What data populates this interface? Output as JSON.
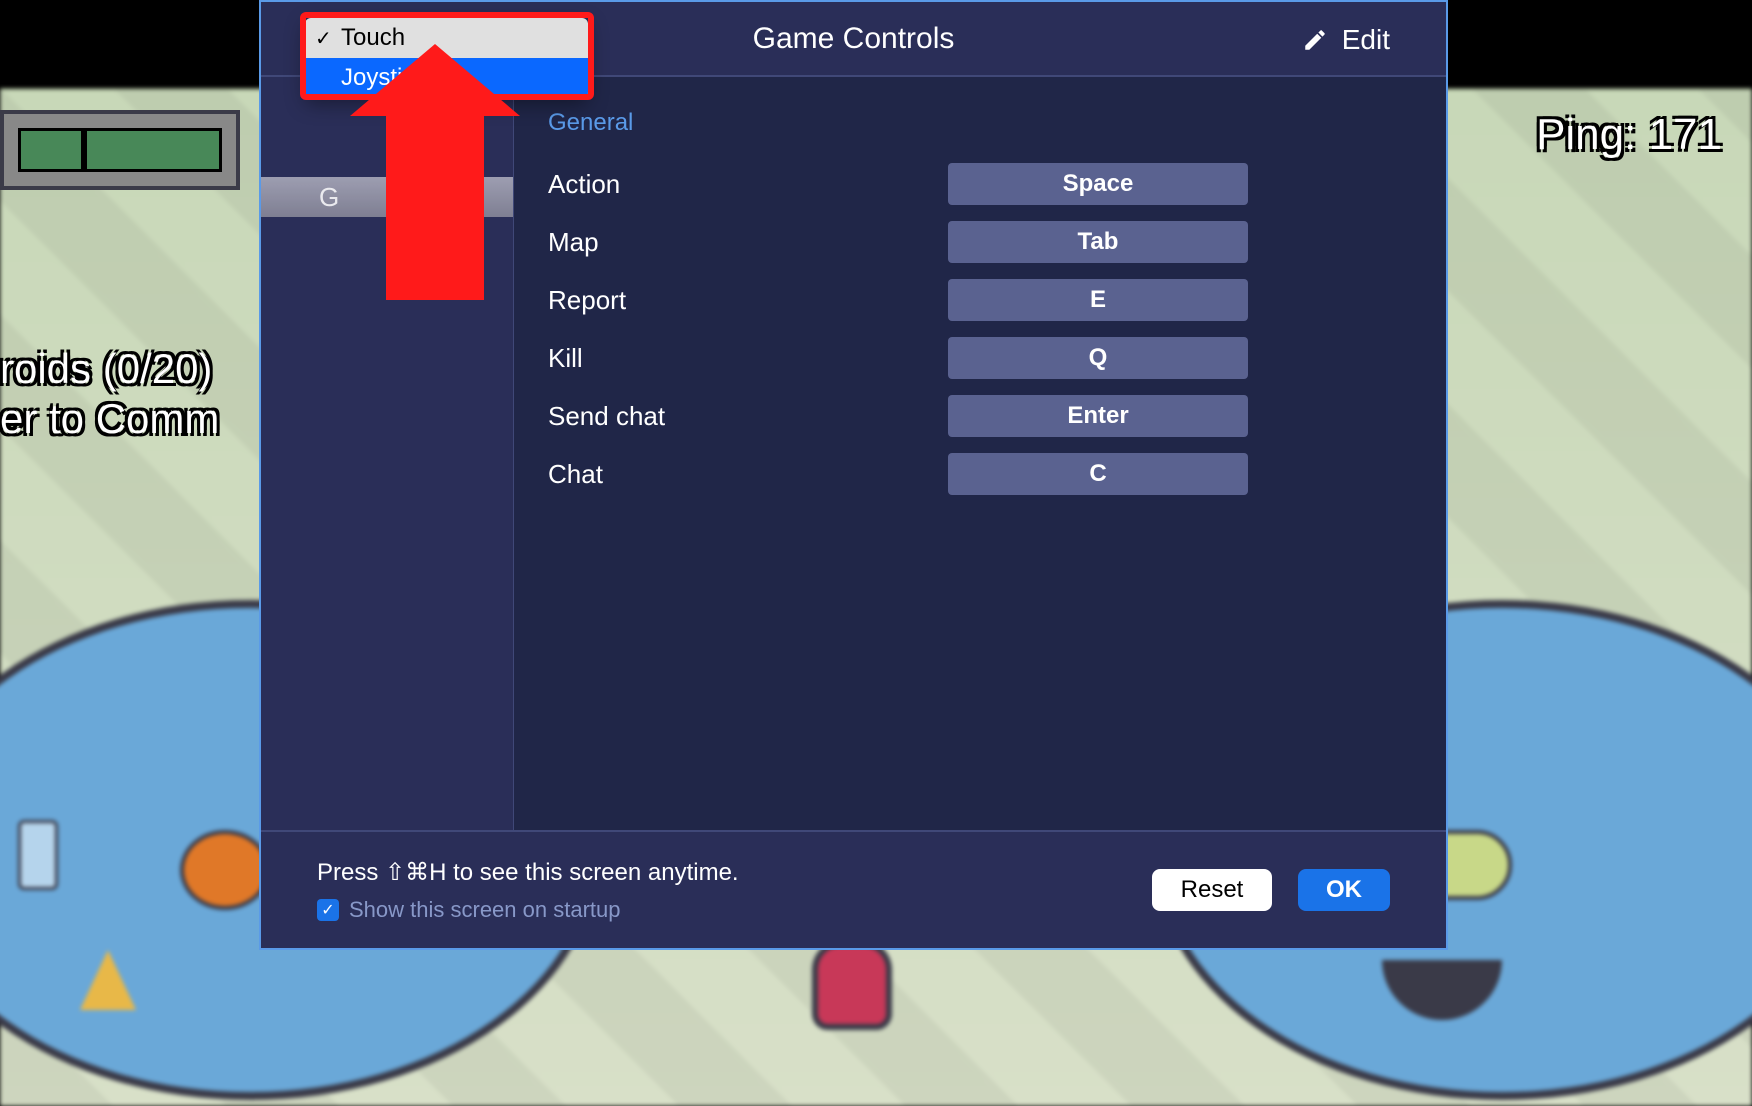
{
  "hud": {
    "ping": "Ping: 171",
    "task1": "roids (0/20)",
    "task2": "er to Comm"
  },
  "modal": {
    "title": "Game Controls",
    "edit_label": "Edit",
    "sidebar_item": "G",
    "section": "General",
    "bindings": [
      {
        "label": "Action",
        "key": "Space"
      },
      {
        "label": "Map",
        "key": "Tab"
      },
      {
        "label": "Report",
        "key": "E"
      },
      {
        "label": "Kill",
        "key": "Q"
      },
      {
        "label": "Send chat",
        "key": "Enter"
      },
      {
        "label": "Chat",
        "key": "C"
      }
    ],
    "footer": {
      "hint": "Press ⇧⌘H to see this screen anytime.",
      "checkbox": "Show this screen on startup",
      "reset": "Reset",
      "ok": "OK"
    }
  },
  "dropdown": {
    "items": [
      {
        "label": "Touch",
        "checked": true,
        "hover": false
      },
      {
        "label": "Joystick",
        "checked": false,
        "hover": true
      }
    ]
  }
}
